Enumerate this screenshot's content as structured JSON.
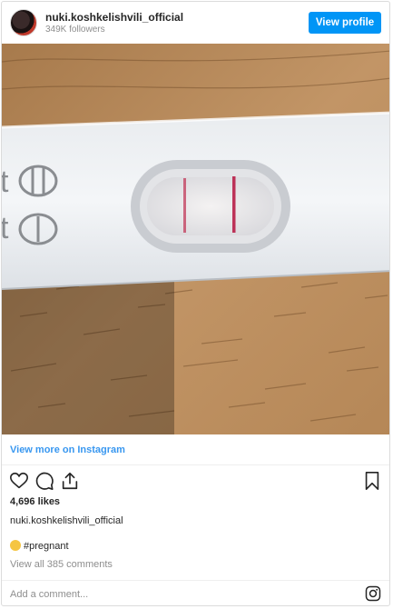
{
  "header": {
    "username": "nuki.koshkelishvili_official",
    "followers": "349K followers",
    "view_profile_label": "View profile"
  },
  "photo": {
    "description_icon": "pregnancy-test-photo"
  },
  "view_more_label": "View more on Instagram",
  "actions": {
    "icons": [
      "heart-icon",
      "comment-icon",
      "share-icon",
      "bookmark-icon"
    ]
  },
  "likes": "4,696 likes",
  "caption_username": "nuki.koshkelishvili_official",
  "hashtag": "#pregnant",
  "view_comments": "View all 385 comments",
  "add_comment_placeholder": "Add a comment...",
  "colors": {
    "accent": "#0095f6",
    "link": "#3897f0",
    "muted": "#8e8e8e"
  }
}
